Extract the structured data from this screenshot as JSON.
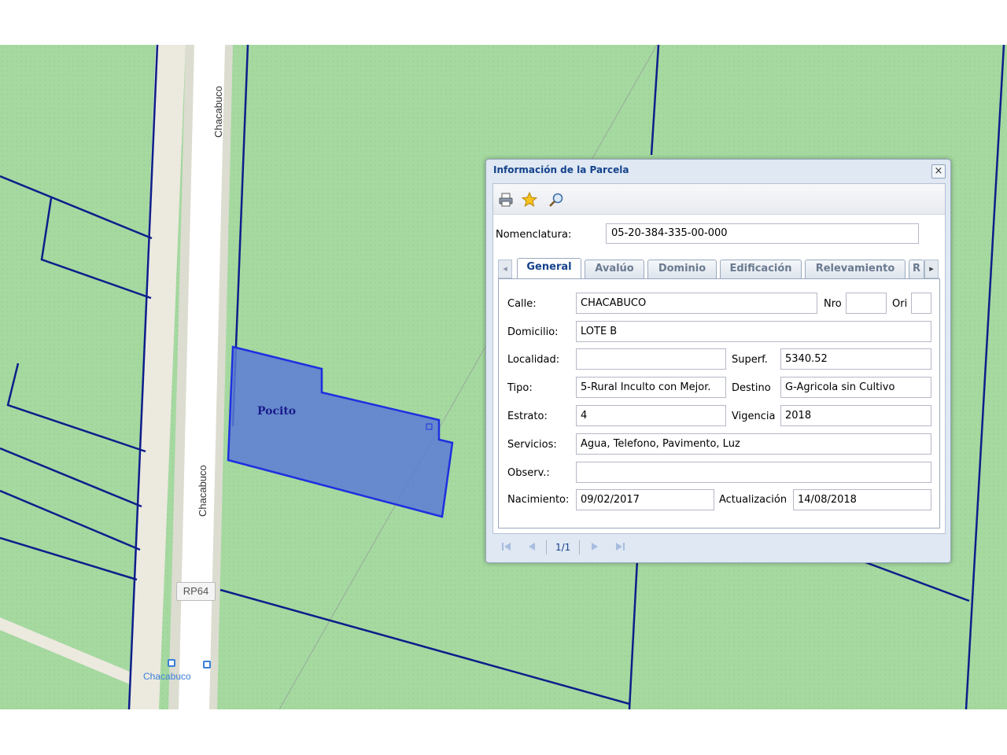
{
  "map": {
    "road_name_upper": "Chacabuco",
    "road_name_lower": "Chacabuco",
    "route_shield": "RP64",
    "bus_stop_label": "Chacabuco",
    "parcel_label": "Pocito",
    "colors": {
      "land": "#a5d9a0",
      "parcel_lines": "#0d1e8a",
      "selected_parcel_fill": "#5b7bd5",
      "selected_parcel_stroke": "#1f2fe0",
      "road": "#ffffff",
      "road_edge": "#dcdcd0",
      "bus_stop": "#3b7fd8"
    }
  },
  "dialog": {
    "title": "Información de la Parcela",
    "close_icon": "close-icon",
    "toolbar": {
      "print_icon": "print-icon",
      "favorite_icon": "star-icon",
      "zoom_icon": "magnifier-icon"
    },
    "nomenclatura": {
      "label": "Nomenclatura:",
      "value": "05-20-384-335-00-000"
    },
    "tabs": [
      {
        "label": "General"
      },
      {
        "label": "Avalúo"
      },
      {
        "label": "Dominio"
      },
      {
        "label": "Edificación"
      },
      {
        "label": "Relevamiento"
      },
      {
        "label": "R"
      }
    ],
    "fields": {
      "calle": {
        "label": "Calle:",
        "value": "CHACABUCO"
      },
      "nro": {
        "label": "Nro",
        "value": ""
      },
      "ori": {
        "label": "Ori",
        "value": ""
      },
      "domicilio": {
        "label": "Domicilio:",
        "value": "LOTE B"
      },
      "localidad": {
        "label": "Localidad:",
        "value": ""
      },
      "superf": {
        "label": "Superf.",
        "value": "5340.52"
      },
      "tipo": {
        "label": "Tipo:",
        "value": "5-Rural Inculto con Mejor."
      },
      "destino": {
        "label": "Destino",
        "value": "G-Agricola sin Cultivo"
      },
      "estrato": {
        "label": "Estrato:",
        "value": "4"
      },
      "vigencia": {
        "label": "Vigencia",
        "value": "2018"
      },
      "servicios": {
        "label": "Servicios:",
        "value": "Agua, Telefono, Pavimento, Luz"
      },
      "observ": {
        "label": "Observ.:",
        "value": ""
      },
      "nacimiento": {
        "label": "Nacimiento:",
        "value": "09/02/2017"
      },
      "actualizacion": {
        "label": "Actualización",
        "value": "14/08/2018"
      }
    },
    "pager": {
      "page_text": "1/1"
    }
  }
}
